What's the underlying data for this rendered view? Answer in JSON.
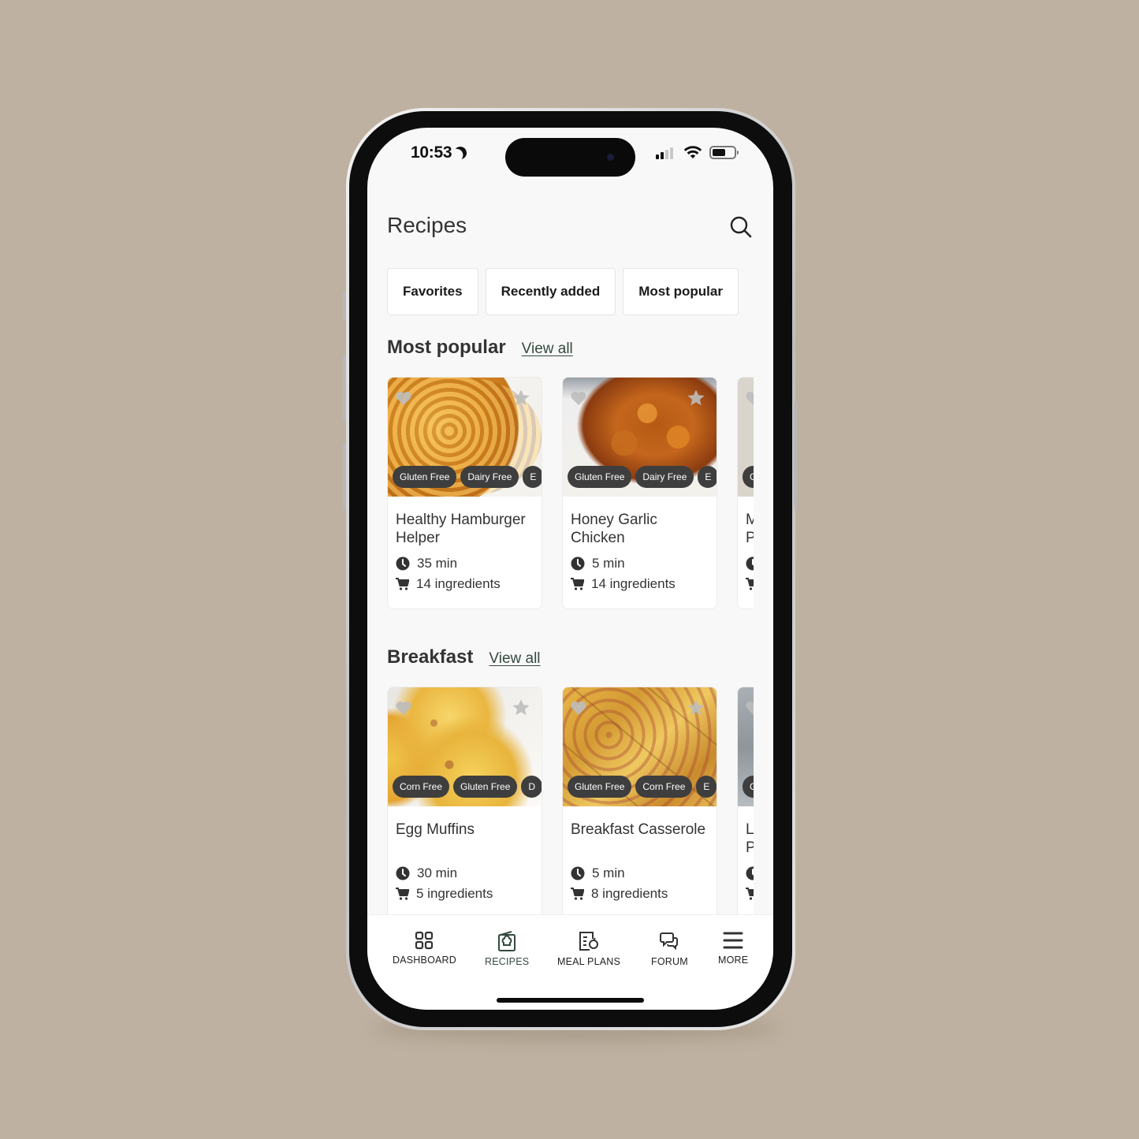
{
  "status_bar": {
    "time": "10:53",
    "focus_icon": "moon-icon",
    "signal_bars_active": 2,
    "signal_bars_total": 4,
    "battery_level": 0.6
  },
  "header": {
    "title": "Recipes",
    "search_icon": "search-icon"
  },
  "filter_chips": [
    {
      "label": "Favorites"
    },
    {
      "label": "Recently added"
    },
    {
      "label": "Most popular"
    }
  ],
  "sections": [
    {
      "title": "Most popular",
      "view_all": "View all",
      "cards": [
        {
          "name": "Healthy Hamburger Helper",
          "tags": [
            "Gluten Free",
            "Dairy Free",
            "E"
          ],
          "time": "35 min",
          "ingredients": "14 ingredients",
          "image": "img-hamburger"
        },
        {
          "name": "Honey Garlic Chicken",
          "tags": [
            "Gluten Free",
            "Dairy Free",
            "E"
          ],
          "time": "5 min",
          "ingredients": "14 ingredients",
          "image": "img-chicken"
        },
        {
          "name": "M P",
          "tags": [
            "G"
          ],
          "time": "",
          "ingredients": "",
          "image": "img-pasta"
        }
      ]
    },
    {
      "title": "Breakfast",
      "view_all": "View all",
      "cards": [
        {
          "name": "Egg Muffins",
          "tags": [
            "Corn Free",
            "Gluten Free",
            "D"
          ],
          "time": "30 min",
          "ingredients": "5 ingredients",
          "image": "img-muffin"
        },
        {
          "name": "Breakfast Casserole",
          "tags": [
            "Gluten Free",
            "Corn Free",
            "E"
          ],
          "time": "5 min",
          "ingredients": "8 ingredients",
          "image": "img-casserole"
        },
        {
          "name": "L P",
          "tags": [
            "G"
          ],
          "time": "",
          "ingredients": "",
          "image": "img-latte"
        }
      ]
    }
  ],
  "tabbar": {
    "active": "RECIPES",
    "items": [
      {
        "label": "DASHBOARD",
        "icon": "grid-icon"
      },
      {
        "label": "RECIPES",
        "icon": "recipe-book-icon"
      },
      {
        "label": "MEAL PLANS",
        "icon": "meal-plan-icon"
      },
      {
        "label": "FORUM",
        "icon": "chat-bubbles-icon"
      },
      {
        "label": "MORE",
        "icon": "hamburger-menu-icon"
      }
    ]
  },
  "colors": {
    "background": "#bfb1a1",
    "screen": "#f8f8f8",
    "accent": "#344a3f",
    "tag_bg": "#3e3e3e",
    "text": "#333333"
  }
}
